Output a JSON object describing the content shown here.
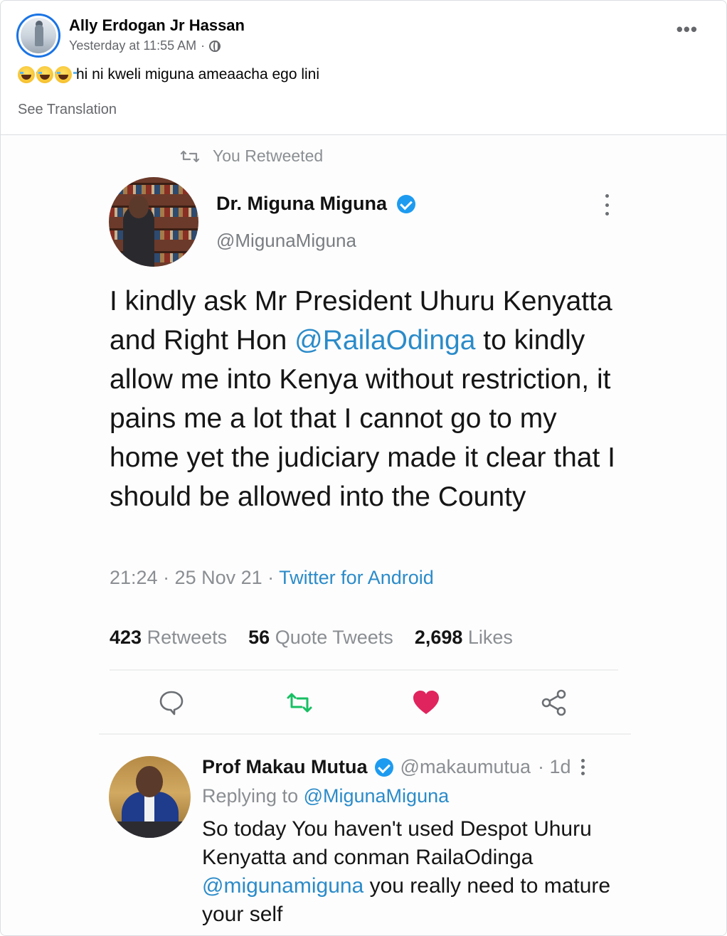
{
  "post": {
    "author": "Ally Erdogan Jr Hassan",
    "timestamp": "Yesterday at 11:55 AM",
    "separator": "·",
    "privacy_icon": "globe-icon",
    "more_icon": "more-options-icon",
    "more_label": "•••",
    "emojis": [
      "face-with-tears-of-joy",
      "face-with-tears-of-joy",
      "face-with-tears-of-joy"
    ],
    "text": "hi ni kweli miguna ameaacha ego lini",
    "see_translation": "See Translation"
  },
  "tweet": {
    "retweet_label": "You Retweeted",
    "author_name": "Dr. Miguna Miguna",
    "author_handle": "@MigunaMiguna",
    "body_part1": "I kindly ask Mr President Uhuru Kenyatta and Right Hon ",
    "body_mention": "@RailaOdinga",
    "body_part2": " to kindly allow me into Kenya without restriction, it pains me a lot that I cannot go to my home yet the judiciary made it clear that I should be allowed into the County",
    "time": "21:24 · 25 Nov 21 · ",
    "source": "Twitter for Android",
    "stats": {
      "retweets_count": "423",
      "retweets_label": "Retweets",
      "quotes_count": "56",
      "quotes_label": "Quote Tweets",
      "likes_count": "2,698",
      "likes_label": "Likes"
    },
    "colors": {
      "link": "#2b8bc9",
      "verified": "#1d9bf0",
      "retweet_active": "#17bf63",
      "like_active": "#e0245e"
    }
  },
  "reply": {
    "author_name": "Prof Makau Mutua",
    "author_handle": "@makaumutua",
    "age": "· 1d",
    "replying_label": "Replying to ",
    "replying_to": "@MigunaMiguna",
    "body_part1": "So today You haven't used Despot Uhuru Kenyatta and conman RailaOdinga ",
    "body_mention": "@migunamiguna",
    "body_part2": " you really need to mature your self"
  }
}
